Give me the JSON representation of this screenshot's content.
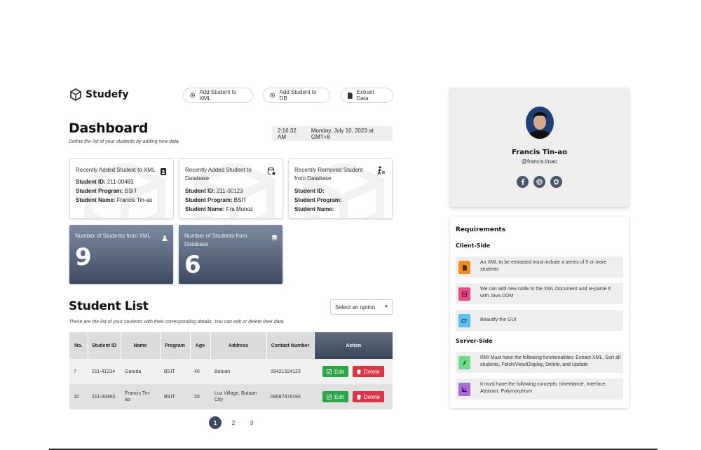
{
  "brand": {
    "name": "Studefy",
    "icon": "cube-logo-icon"
  },
  "toolbar": {
    "add_xml_label": "Add Student to XML",
    "add_db_label": "Add Student to DB",
    "extract_label": "Extract Data"
  },
  "dashboard": {
    "title": "Dashboard",
    "subtitle": "Define the list of your students by adding new data",
    "time": "2:16:32 AM",
    "date": "Monday, July 10, 2023 at GMT+8"
  },
  "cards": [
    {
      "title": "Recently Added Student to XML",
      "id_label": "Student ID:",
      "id": "211-00483",
      "program_label": "Student Program:",
      "program": "BSIT",
      "name_label": "Student Name:",
      "name": "Francis Tin-ao",
      "icon": "id-card-icon"
    },
    {
      "title": "Recently Added Student to Database",
      "id_label": "Student ID:",
      "id": "211-00123",
      "program_label": "Student Program:",
      "program": "BSIT",
      "name_label": "Student Name:",
      "name": "Fra Munoz",
      "icon": "database-check-icon"
    },
    {
      "title": "Recently Removed Student from Database",
      "id_label": "Student ID:",
      "id": "",
      "program_label": "Student Program:",
      "program": "",
      "name_label": "Student Name:",
      "name": "",
      "icon": "person-leaving-icon"
    }
  ],
  "stats": [
    {
      "label": "Number of Students from XML",
      "value": "9",
      "icon": "xml-users-icon"
    },
    {
      "label": "Number of Students from Database",
      "value": "6",
      "icon": "database-icon"
    }
  ],
  "student_list": {
    "title": "Student List",
    "subtitle": "These are the list of your students with their corresponding details. You can edit or delete their data",
    "select_placeholder": "Select an option",
    "headers": [
      "No.",
      "Student ID",
      "Name",
      "Program",
      "Age",
      "Address",
      "Contact Number",
      "Action"
    ],
    "rows": [
      {
        "no": "7",
        "id": "211-41234",
        "name": "Garuda",
        "program": "BSIT",
        "age": "40",
        "address": "Butuan",
        "contact": "09421324123"
      },
      {
        "no": "10",
        "id": "211-00483",
        "name": "Francis Tin-ao",
        "program": "BSIT",
        "age": "20",
        "address": "Luz Village, Butuan City",
        "contact": "09087479193"
      }
    ],
    "edit_label": "Edit",
    "delete_label": "Delete",
    "pages": [
      "1",
      "2",
      "3"
    ],
    "current_page": "1"
  },
  "profile": {
    "name": "Francis Tin-ao",
    "handle": "@francis.tinao",
    "socials": [
      "facebook-icon",
      "web-icon",
      "github-icon"
    ]
  },
  "requirements": {
    "title": "Requirements",
    "client_title": "Client-Side",
    "client": [
      {
        "text": "An XML to be extracted must include a series of 5 or more students",
        "color": "#f28c28"
      },
      {
        "text": "We can add new node to the XML Document and re-parse it with Java DOM",
        "color": "#e84a8a"
      },
      {
        "text": "Beautify the GUI",
        "color": "#5bc0eb"
      }
    ],
    "server_title": "Server-Side",
    "server": [
      {
        "text": "RMI Must have the following functionalities: Extract XML, Sort all students, Fetch/View/Display, Delete, and Update",
        "color": "#6fdc8c"
      },
      {
        "text": "It must have the following concepts: Inheritance, Interface, Abstract, Polymorphism",
        "color": "#a66bd9"
      }
    ]
  },
  "colors": {
    "stat_gradient_top": "#7d8ba1",
    "stat_gradient_bottom": "#3e4a61",
    "edit": "#28a745",
    "delete": "#dc3545"
  }
}
